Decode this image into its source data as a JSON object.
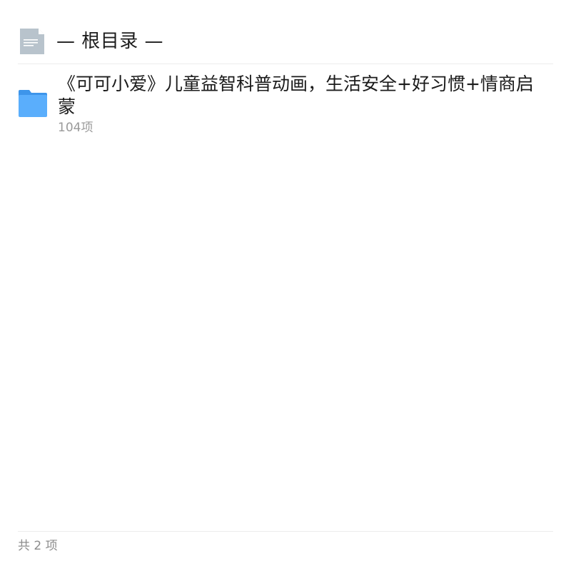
{
  "header": {
    "icon": "document-icon",
    "title": "— 根目录 —"
  },
  "items": [
    {
      "icon": "folder-icon",
      "name": "《可可小爱》儿童益智科普动画，生活安全+好习惯+情商启蒙",
      "count": "104项"
    }
  ],
  "footer": {
    "total": "共 2 项"
  },
  "colors": {
    "folder": "#5aaefc",
    "folder_tab": "#3d95ea",
    "document": "#b8c3cc",
    "divider": "#ececec",
    "secondary_text": "#9a9a9a"
  }
}
